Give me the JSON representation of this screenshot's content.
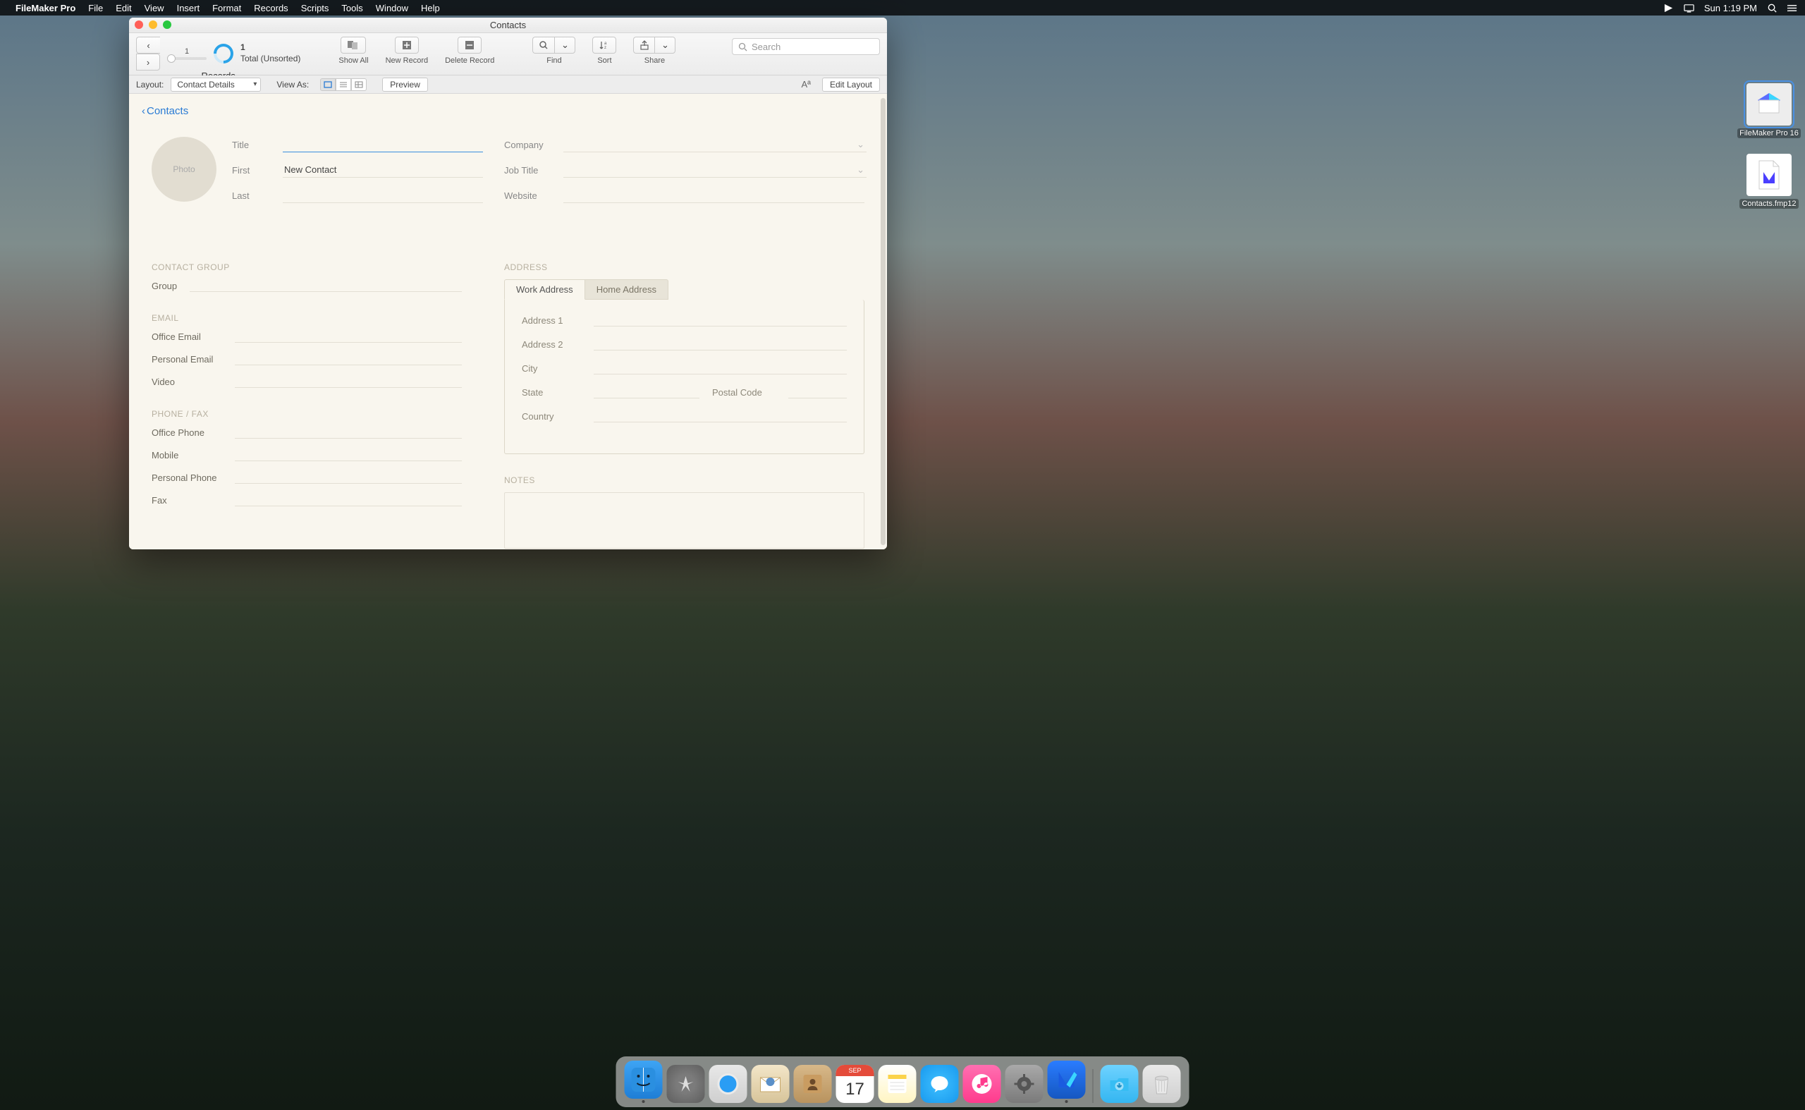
{
  "menubar": {
    "app_name": "FileMaker Pro",
    "menus": [
      "File",
      "Edit",
      "View",
      "Insert",
      "Format",
      "Records",
      "Scripts",
      "Tools",
      "Window",
      "Help"
    ],
    "clock": "Sun 1:19 PM"
  },
  "desktop": {
    "app_icon_label": "FileMaker Pro 16",
    "file_icon_label": "Contacts.fmp12"
  },
  "window": {
    "title": "Contacts",
    "records": {
      "current": "1",
      "total": "1",
      "status": "Total (Unsorted)",
      "group_label": "Records"
    },
    "toolbar": {
      "show_all": "Show All",
      "new_record": "New Record",
      "delete_record": "Delete Record",
      "find": "Find",
      "sort": "Sort",
      "share": "Share",
      "search_placeholder": "Search"
    },
    "layoutbar": {
      "layout_label": "Layout:",
      "layout_value": "Contact Details",
      "view_as": "View As:",
      "preview": "Preview",
      "edit_layout": "Edit Layout"
    }
  },
  "content": {
    "back": "Contacts",
    "photo": "Photo",
    "left_fields": {
      "title": "Title",
      "first": "First",
      "first_value": "New Contact",
      "last": "Last"
    },
    "right_fields": {
      "company": "Company",
      "job_title": "Job Title",
      "website": "Website"
    },
    "sections": {
      "contact_group": "CONTACT GROUP",
      "group": "Group",
      "email": "EMAIL",
      "office_email": "Office Email",
      "personal_email": "Personal Email",
      "video": "Video",
      "phone_fax": "PHONE / FAX",
      "office_phone": "Office Phone",
      "mobile": "Mobile",
      "personal_phone": "Personal Phone",
      "fax": "Fax",
      "address": "ADDRESS",
      "work_tab": "Work Address",
      "home_tab": "Home Address",
      "address1": "Address 1",
      "address2": "Address 2",
      "city": "City",
      "state": "State",
      "postal": "Postal Code",
      "country": "Country",
      "notes": "NOTES"
    }
  },
  "dock": {
    "cal_month": "SEP",
    "cal_day": "17"
  }
}
